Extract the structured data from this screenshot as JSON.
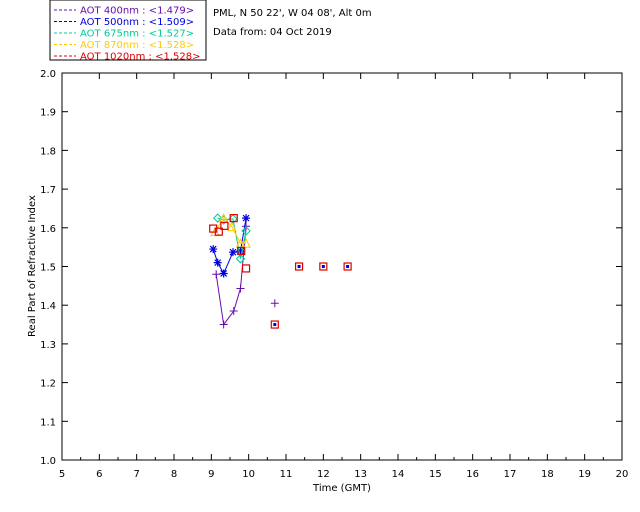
{
  "header": {
    "location": "PML, N 50 22', W 04 08', Alt 0m",
    "date": "Data from: 04 Oct 2019"
  },
  "chart_data": {
    "type": "scatter",
    "xlabel": "Time (GMT)",
    "ylabel": "Real Part of Refractive Index",
    "xlim": [
      5,
      20
    ],
    "ylim": [
      1.0,
      2.0
    ],
    "xticks": [
      "5",
      "6",
      "7",
      "8",
      "9",
      "10",
      "11",
      "12",
      "13",
      "14",
      "15",
      "16",
      "17",
      "18",
      "19",
      "20"
    ],
    "yticks": [
      "1.0",
      "1.1",
      "1.2",
      "1.3",
      "1.4",
      "1.5",
      "1.6",
      "1.7",
      "1.8",
      "1.9",
      "2.0"
    ],
    "legend_position": "top-left",
    "series": [
      {
        "name": "AOT  400nm : <1.479>",
        "color": "#6a0dad",
        "marker": "plus",
        "connected": true,
        "points": [
          [
            9.13,
            1.48
          ],
          [
            9.33,
            1.35
          ],
          [
            9.6,
            1.385
          ],
          [
            9.78,
            1.443
          ],
          [
            9.93,
            1.604
          ]
        ],
        "extra_points": [
          [
            10.7,
            1.405
          ]
        ]
      },
      {
        "name": "AOT  500nm : <1.509>",
        "color": "#0000dd",
        "marker": "star",
        "connected": true,
        "points": [
          [
            9.05,
            1.545
          ],
          [
            9.17,
            1.51
          ],
          [
            9.33,
            1.482
          ],
          [
            9.58,
            1.537
          ],
          [
            9.78,
            1.54
          ],
          [
            9.93,
            1.625
          ]
        ],
        "extra_points": []
      },
      {
        "name": "AOT  675nm : <1.527>",
        "color": "#00cc99",
        "marker": "diamond",
        "connected": true,
        "points": [
          [
            9.17,
            1.625
          ],
          [
            9.33,
            1.62
          ],
          [
            9.58,
            1.623
          ],
          [
            9.78,
            1.52
          ],
          [
            9.93,
            1.592
          ]
        ],
        "extra_points": []
      },
      {
        "name": "AOT  870nm : <1.528>",
        "color": "#ffcc00",
        "marker": "triangle",
        "connected": true,
        "points": [
          [
            9.1,
            1.59
          ],
          [
            9.33,
            1.625
          ],
          [
            9.55,
            1.603
          ],
          [
            9.78,
            1.56
          ],
          [
            9.93,
            1.56
          ]
        ],
        "extra_points": []
      },
      {
        "name": "AOT 1020nm : <1.528>",
        "color": "#dd0000",
        "marker": "square",
        "connected": false,
        "points": [
          [
            9.05,
            1.598
          ],
          [
            9.2,
            1.59
          ],
          [
            9.35,
            1.605
          ],
          [
            9.6,
            1.625
          ],
          [
            9.8,
            1.54
          ],
          [
            9.93,
            1.495
          ],
          [
            10.7,
            1.35
          ],
          [
            11.35,
            1.5
          ],
          [
            12.0,
            1.5
          ],
          [
            12.65,
            1.5
          ]
        ],
        "extra_points": []
      }
    ],
    "overlay_markers": [
      {
        "marker": "dot",
        "color": "#0000dd",
        "points": [
          [
            10.7,
            1.35
          ],
          [
            11.35,
            1.5
          ],
          [
            12.0,
            1.5
          ],
          [
            12.65,
            1.5
          ]
        ]
      }
    ]
  }
}
